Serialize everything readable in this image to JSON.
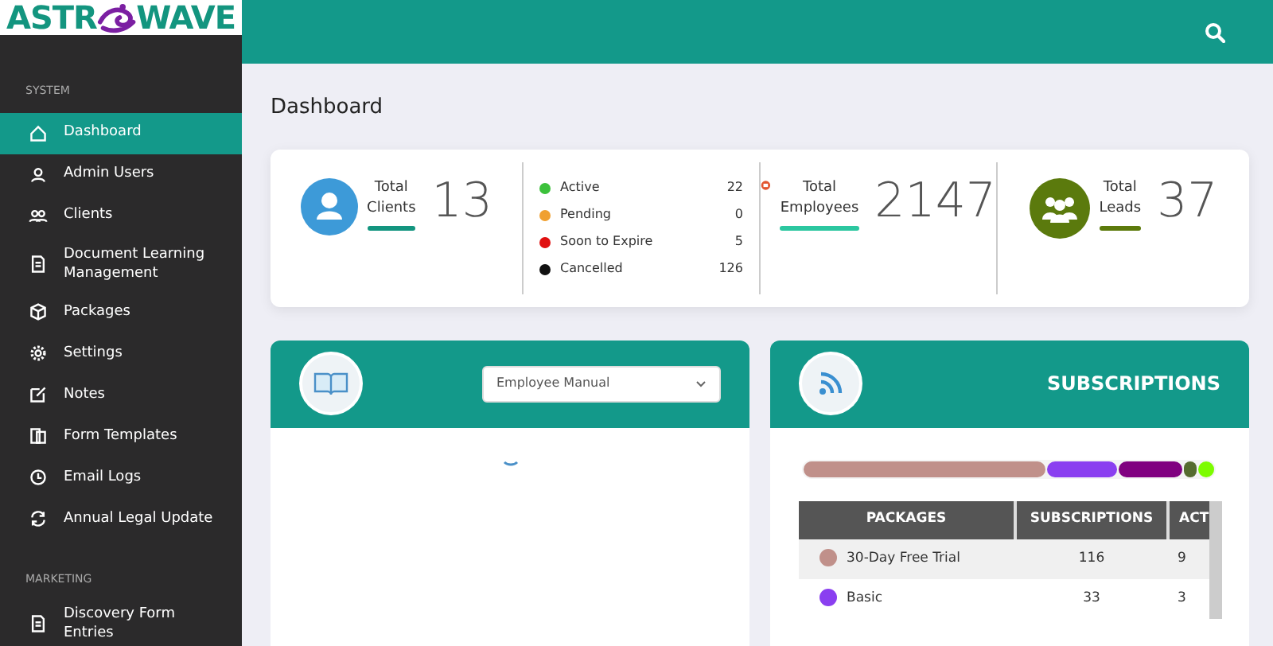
{
  "logo": {
    "before": "ASTR",
    "after": "WAVE"
  },
  "sidebar": {
    "sections": [
      {
        "title": "SYSTEM",
        "items": [
          {
            "label": "Dashboard",
            "selected": true
          },
          {
            "label": "Admin Users",
            "selected": false
          },
          {
            "label": "Clients",
            "selected": false
          },
          {
            "label": "Document Learning Management",
            "selected": false
          },
          {
            "label": "Packages",
            "selected": false
          },
          {
            "label": "Settings",
            "selected": false
          },
          {
            "label": "Notes",
            "selected": false
          },
          {
            "label": "Form Templates",
            "selected": false
          },
          {
            "label": "Email Logs",
            "selected": false
          },
          {
            "label": "Annual Legal Update",
            "selected": false
          }
        ]
      },
      {
        "title": "MARKETING",
        "items": [
          {
            "label": "Discovery Form Entries",
            "selected": false
          }
        ]
      }
    ]
  },
  "page_title": "Dashboard",
  "stats": {
    "clients": {
      "label_1": "Total",
      "label_2": "Clients",
      "value": "13"
    },
    "statuses": [
      {
        "label": "Active",
        "count": "22",
        "color": "#3cc13b"
      },
      {
        "label": "Pending",
        "count": "0",
        "color": "#f0a030"
      },
      {
        "label": "Soon to Expire",
        "count": "5",
        "color": "#e01010"
      },
      {
        "label": "Cancelled",
        "count": "126",
        "color": "#111111"
      }
    ],
    "employees": {
      "label_1": "Total",
      "label_2": "Employees",
      "value": "2147"
    },
    "leads": {
      "label_1": "Total",
      "label_2": "Leads",
      "value": "37"
    }
  },
  "documents_panel": {
    "select": {
      "value": "Employee Manual"
    }
  },
  "subscriptions_panel": {
    "title": "SUBSCRIPTIONS",
    "segments": [
      {
        "color": "#c0908a"
      },
      {
        "color": "#8a3ff0"
      },
      {
        "color": "#800080"
      },
      {
        "color": "#556b2f"
      },
      {
        "color": "#7cfc00"
      }
    ],
    "table": {
      "columns": [
        "PACKAGES",
        "SUBSCRIPTIONS",
        "ACT"
      ],
      "rows": [
        {
          "color": "#c0908a",
          "cells": [
            "30-Day Free Trial",
            "116",
            "9"
          ]
        },
        {
          "color": "#8a3ff0",
          "cells": [
            "Basic",
            "33",
            "3"
          ]
        }
      ]
    }
  }
}
